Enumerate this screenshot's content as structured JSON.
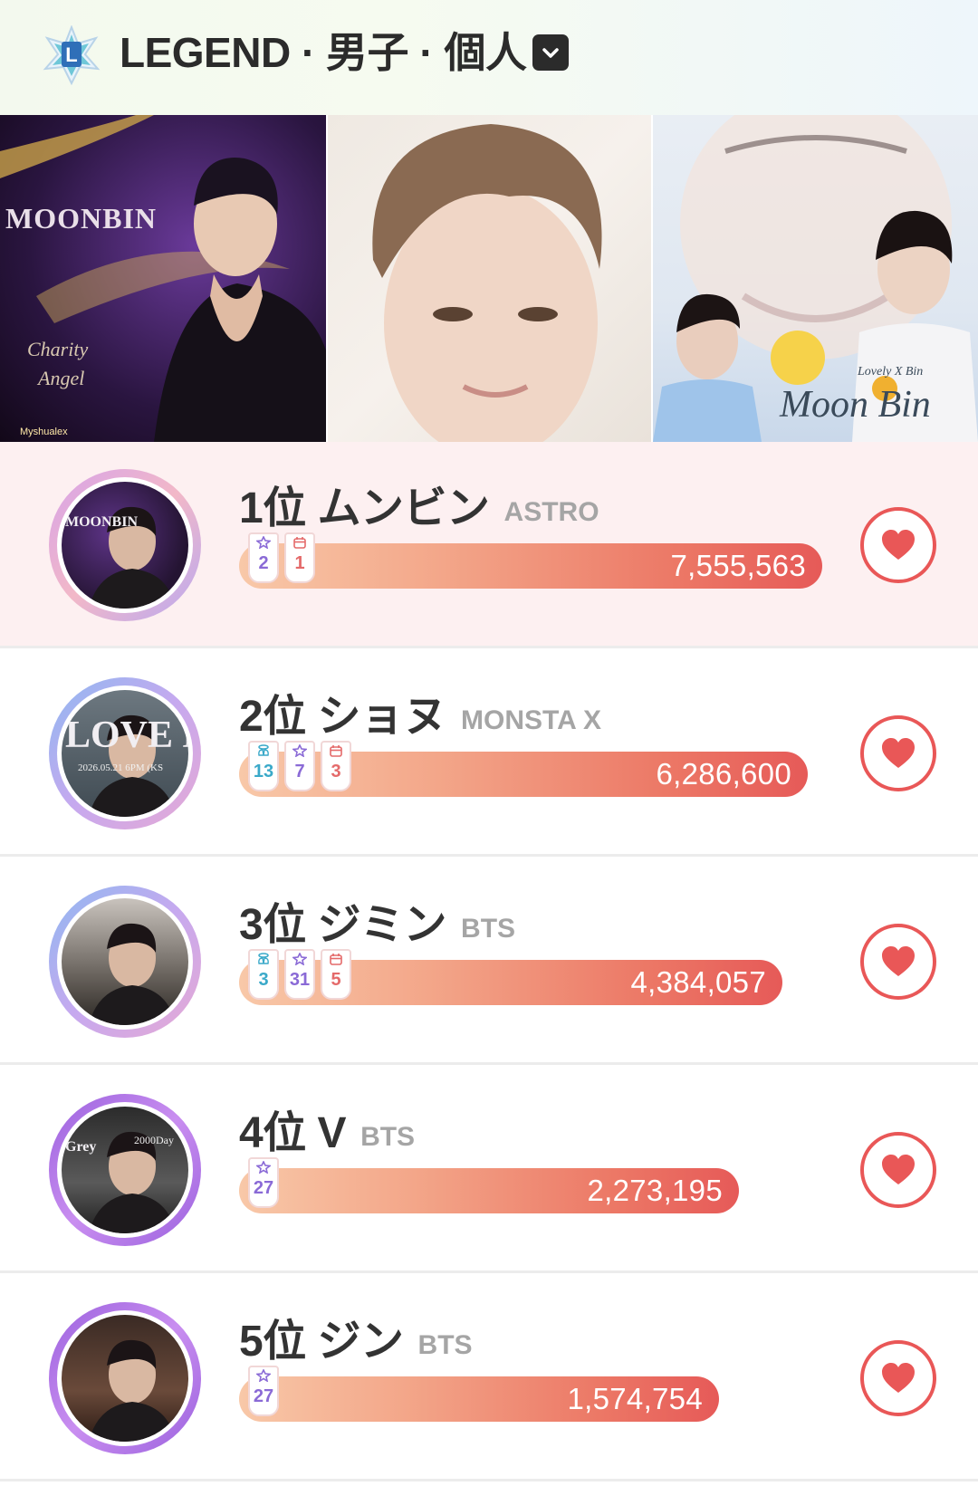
{
  "header": {
    "title": "LEGEND · 男子 · 個人",
    "logo_letter": "L"
  },
  "banners": [
    {
      "text": "MOONBIN",
      "sub1": "Charity",
      "sub2": "Angel",
      "credit": "Myshualex"
    },
    {},
    {
      "sign": "Moon Bin",
      "tag": "Lovely X Bin"
    }
  ],
  "rankings": [
    {
      "rank_label": "1位 ムンビン",
      "group": "ASTRO",
      "count": "7,555,563",
      "badges": [
        {
          "icon": "star",
          "num": "2"
        },
        {
          "icon": "calendar",
          "num": "1"
        }
      ],
      "avatar_text": "MOONBIN"
    },
    {
      "rank_label": "2位 ショヌ",
      "group": "MONSTA X",
      "count": "6,286,600",
      "badges": [
        {
          "icon": "angel",
          "num": "13"
        },
        {
          "icon": "star",
          "num": "7"
        },
        {
          "icon": "calendar",
          "num": "3"
        }
      ],
      "avatar_text": "LOVE M",
      "avatar_sub": "2026.05.21 6PM (KS"
    },
    {
      "rank_label": "3位 ジミン",
      "group": "BTS",
      "count": "4,384,057",
      "badges": [
        {
          "icon": "angel",
          "num": "3"
        },
        {
          "icon": "star",
          "num": "31"
        },
        {
          "icon": "calendar",
          "num": "5"
        }
      ]
    },
    {
      "rank_label": "4位 V",
      "group": "BTS",
      "count": "2,273,195",
      "badges": [
        {
          "icon": "star",
          "num": "27"
        }
      ],
      "avatar_text": "Grey",
      "avatar_sub": "2000Day"
    },
    {
      "rank_label": "5位 ジン",
      "group": "BTS",
      "count": "1,574,754",
      "badges": [
        {
          "icon": "star",
          "num": "27"
        }
      ]
    }
  ],
  "colors": {
    "accent": "#e95757",
    "star_badge": "#8a6ad6",
    "angel_badge": "#3aa9c9",
    "calendar_badge": "#e46a6a"
  }
}
